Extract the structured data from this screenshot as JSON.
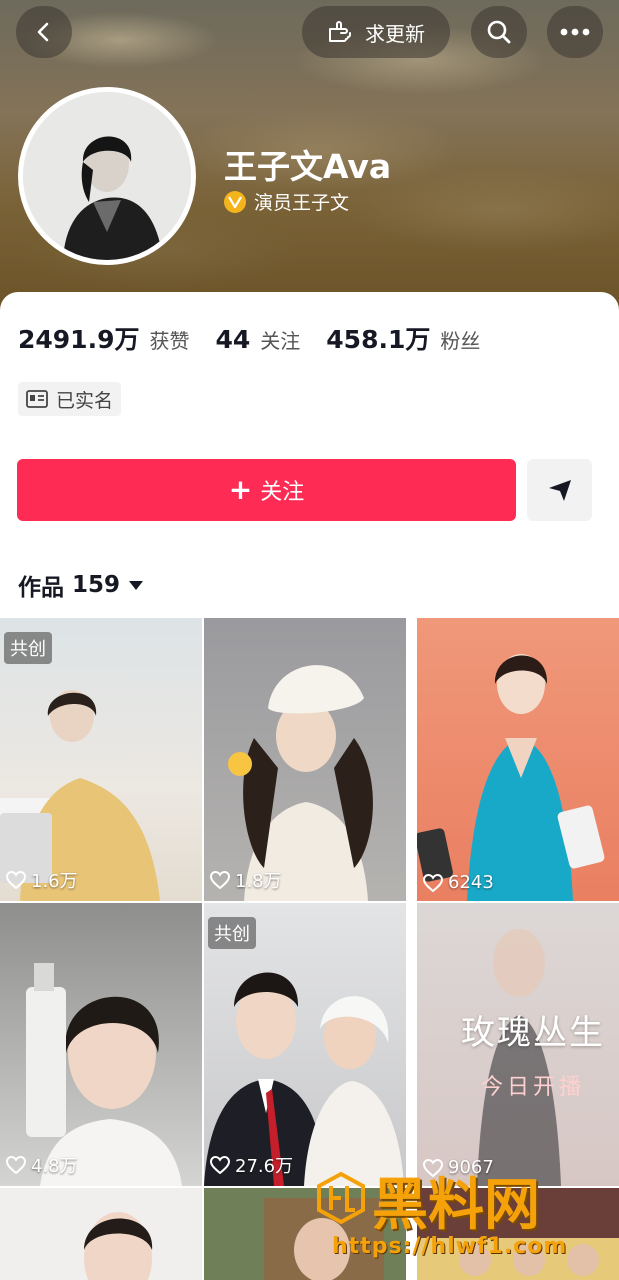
{
  "top_bar": {
    "update_label": "求更新"
  },
  "profile": {
    "name": "王子文Ava",
    "verification": "演员王子文",
    "stats": [
      {
        "value": "2491.9万",
        "label": "获赞"
      },
      {
        "value": "44",
        "label": "关注"
      },
      {
        "value": "458.1万",
        "label": "粉丝"
      }
    ],
    "realname_badge": "已实名",
    "follow_label": "关注"
  },
  "works": {
    "label": "作品",
    "count": "159",
    "tiles": [
      {
        "likes": "1.6万",
        "badge": "共创"
      },
      {
        "likes": "1.8万",
        "badge": ""
      },
      {
        "likes": "6243",
        "badge": ""
      },
      {
        "likes": "4.8万",
        "badge": ""
      },
      {
        "likes": "27.6万",
        "badge": "共创"
      },
      {
        "likes": "9067",
        "badge": "",
        "overlay_title": "玫瑰丛生",
        "overlay_sub": "今日开播"
      }
    ]
  },
  "watermark": {
    "brand": "黑料网",
    "url": "https://hlwf1.com"
  },
  "colors": {
    "accent": "#fe2c55",
    "verify": "#f3b51b"
  }
}
